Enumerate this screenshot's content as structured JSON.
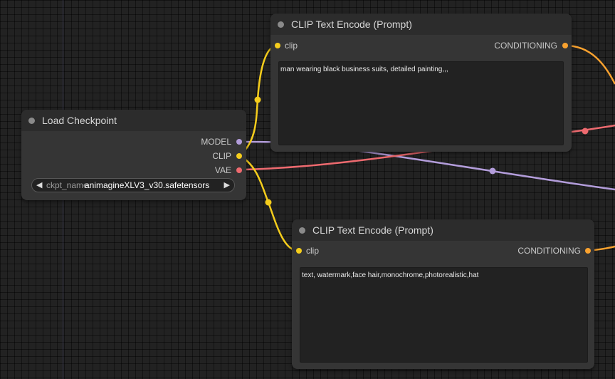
{
  "colors": {
    "clip": "#f5cd1c",
    "conditioning": "#f9a22f",
    "model": "#b39ddb",
    "vae": "#ee6a6f"
  },
  "load_checkpoint": {
    "title": "Load Checkpoint",
    "outputs": [
      "MODEL",
      "CLIP",
      "VAE"
    ],
    "widget_label": "ckpt_name",
    "widget_value": "animagineXLV3_v30.safetensors"
  },
  "clip_encode_positive": {
    "title": "CLIP Text Encode (Prompt)",
    "input": "clip",
    "output": "CONDITIONING",
    "text": "man wearing black business suits, detailed painting,,,"
  },
  "clip_encode_negative": {
    "title": "CLIP Text Encode (Prompt)",
    "input": "clip",
    "output": "CONDITIONING",
    "text": "text, watermark,face hair,monochrome,photorealistic,hat"
  }
}
